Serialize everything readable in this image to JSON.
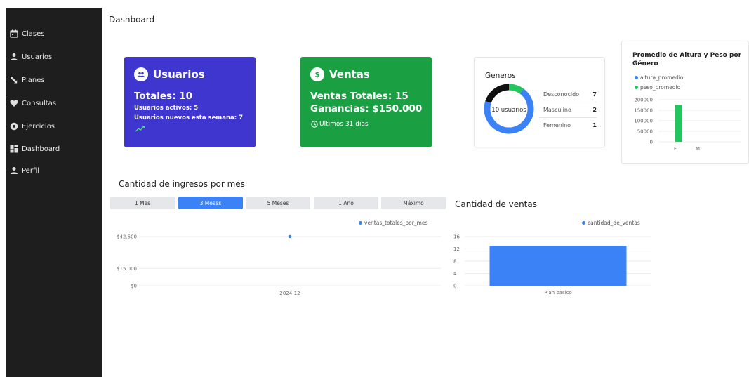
{
  "sidebar": {
    "items": [
      {
        "label": "Clases",
        "icon": "calendar-icon"
      },
      {
        "label": "Usuarios",
        "icon": "user-icon"
      },
      {
        "label": "Planes",
        "icon": "arrows-icon"
      },
      {
        "label": "Consultas",
        "icon": "heart-icon"
      },
      {
        "label": "Ejercicios",
        "icon": "ball-icon"
      },
      {
        "label": "Dashboard",
        "icon": "dashboard-icon"
      },
      {
        "label": "Perfil",
        "icon": "user-icon"
      }
    ]
  },
  "page": {
    "title": "Dashboard"
  },
  "users_card": {
    "title": "Usuarios",
    "totales": "Totales: 10",
    "activos": "Usuarios activos: 5",
    "nuevos": "Usuarios nuevos esta semana: 7",
    "color": "#3f35cf"
  },
  "sales_card": {
    "title": "Ventas",
    "totales": "Ventas Totales: 15",
    "ganancias": "Ganancias: $150.000",
    "period": "Ultimos 31 dias",
    "color": "#1a9f43"
  },
  "genders_card": {
    "title": "Generos",
    "center_label": "10 usuarios",
    "rows": [
      {
        "label": "Desconocido",
        "value": "7",
        "color": "#3b82f6"
      },
      {
        "label": "Masculino",
        "value": "2",
        "color": "#111111"
      },
      {
        "label": "Femenino",
        "value": "1",
        "color": "#22c55e"
      }
    ]
  },
  "height_weight_chart": {
    "title": "Promedio de Altura y Peso por Género",
    "legend": [
      {
        "name": "altura_promedio",
        "color": "#3b82f6"
      },
      {
        "name": "peso_promedio",
        "color": "#22c55e"
      }
    ],
    "chart_data": {
      "type": "bar",
      "categories": [
        "F",
        "M"
      ],
      "series": [
        {
          "name": "altura_promedio",
          "values": [
            0,
            0
          ]
        },
        {
          "name": "peso_promedio",
          "values": [
            175000,
            0
          ]
        }
      ],
      "yticks": [
        "200000",
        "150000",
        "100000",
        "50000",
        "0"
      ],
      "ylim": [
        0,
        200000
      ]
    }
  },
  "income_chart": {
    "title": "Cantidad de ingresos por mes",
    "ranges": [
      {
        "label": "1 Mes",
        "active": false
      },
      {
        "label": "3 Meses",
        "active": true
      },
      {
        "label": "5 Meses",
        "active": false
      },
      {
        "label": "1 Año",
        "active": false
      },
      {
        "label": "Máximo",
        "active": false
      }
    ],
    "legend": "ventas_totales_por_mes",
    "legend_color": "#3b82f6",
    "chart_data": {
      "type": "scatter",
      "x": [
        "2024-12"
      ],
      "series": [
        {
          "name": "ventas_totales_por_mes",
          "values": [
            42500
          ]
        }
      ],
      "yticks": [
        "$42.500",
        "$15.000",
        "$0"
      ],
      "ylim": [
        0,
        42500
      ]
    }
  },
  "sales_chart": {
    "title": "Cantidad de ventas",
    "legend": "cantidad_de_ventas",
    "legend_color": "#3b82f6",
    "chart_data": {
      "type": "bar",
      "categories": [
        "Plan basico"
      ],
      "series": [
        {
          "name": "cantidad_de_ventas",
          "values": [
            13
          ]
        }
      ],
      "yticks": [
        "16",
        "12",
        "8",
        "4",
        "0"
      ],
      "ylim": [
        0,
        16
      ]
    }
  }
}
